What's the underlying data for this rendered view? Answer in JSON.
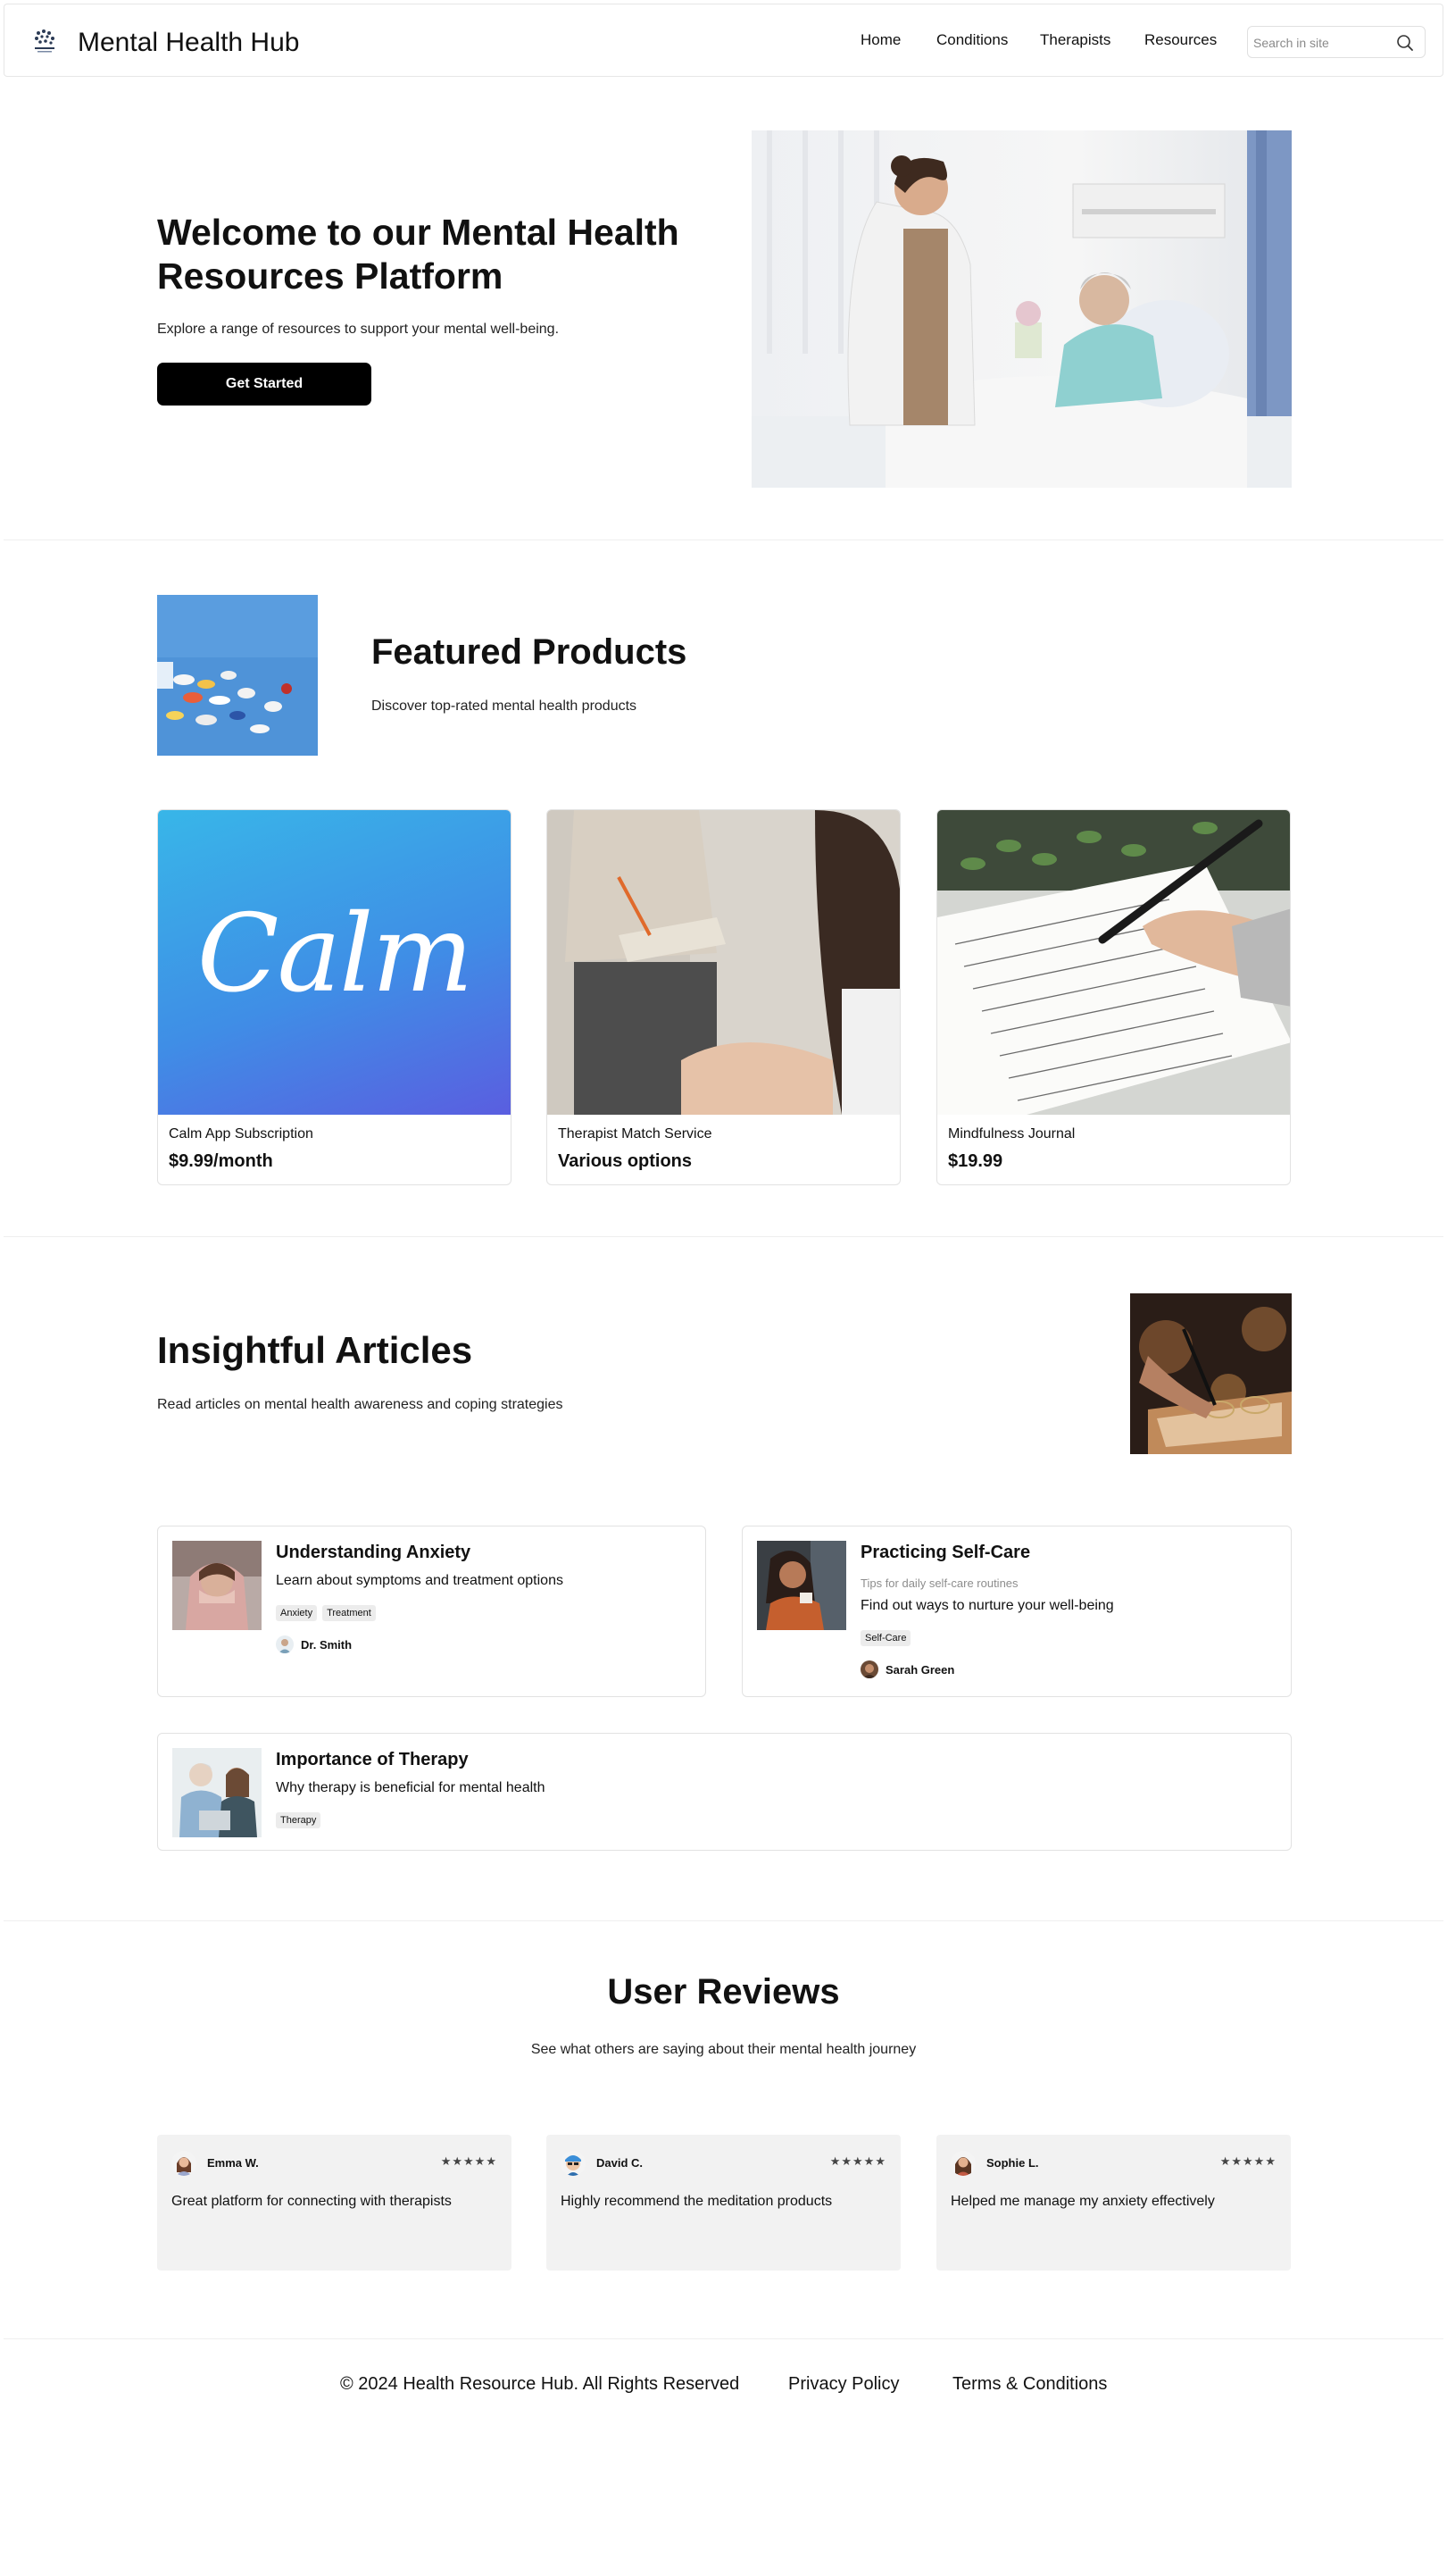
{
  "header": {
    "brand": "Mental Health Hub",
    "nav": [
      "Home",
      "Conditions",
      "Therapists",
      "Resources"
    ],
    "search_placeholder": "Search in site"
  },
  "hero": {
    "title": "Welcome to our Mental Health Resources Platform",
    "subtitle": "Explore a range of resources to support your mental well-being.",
    "cta": "Get Started"
  },
  "featured": {
    "title": "Featured Products",
    "subtitle": "Discover top-rated mental health products",
    "products": [
      {
        "name": "Calm App Subscription",
        "price": "$9.99/month",
        "logo_text": "Calm"
      },
      {
        "name": "Therapist Match Service",
        "price": "Various options"
      },
      {
        "name": "Mindfulness Journal",
        "price": "$19.99"
      }
    ]
  },
  "articles": {
    "title": "Insightful Articles",
    "subtitle": "Read articles on mental health awareness and coping strategies",
    "items": [
      {
        "title": "Understanding Anxiety",
        "description": "Learn about symptoms and treatment options",
        "tags": [
          "Anxiety",
          "Treatment"
        ],
        "author": "Dr. Smith"
      },
      {
        "title": "Practicing Self-Care",
        "subtitle": "Tips for daily self-care routines",
        "description": "Find out ways to nurture your well-being",
        "tags": [
          "Self-Care"
        ],
        "author": "Sarah Green"
      },
      {
        "title": "Importance of Therapy",
        "description": "Why therapy is beneficial for mental health",
        "tags": [
          "Therapy"
        ]
      }
    ]
  },
  "reviews": {
    "title": "User Reviews",
    "subtitle": "See what others are saying about their mental health journey",
    "items": [
      {
        "name": "Emma W.",
        "stars": "★★★★★",
        "rating": 5,
        "text": "Great platform for connecting with therapists"
      },
      {
        "name": "David C.",
        "stars": "★★★★★",
        "rating": 5,
        "text": "Highly recommend the meditation products"
      },
      {
        "name": "Sophie L.",
        "stars": "★★★★★",
        "rating": 5,
        "text": "Helped me manage my anxiety effectively"
      }
    ]
  },
  "footer": {
    "copyright": "© 2024 Health Resource Hub. All Rights Reserved",
    "links": [
      "Privacy Policy",
      "Terms & Conditions"
    ]
  },
  "colors": {
    "button_bg": "#000000",
    "review_bg": "#f2f2f2",
    "tag_bg": "#ececec",
    "calm_gradient_top": "#38b6e8",
    "calm_gradient_bottom": "#5a5ee0"
  }
}
